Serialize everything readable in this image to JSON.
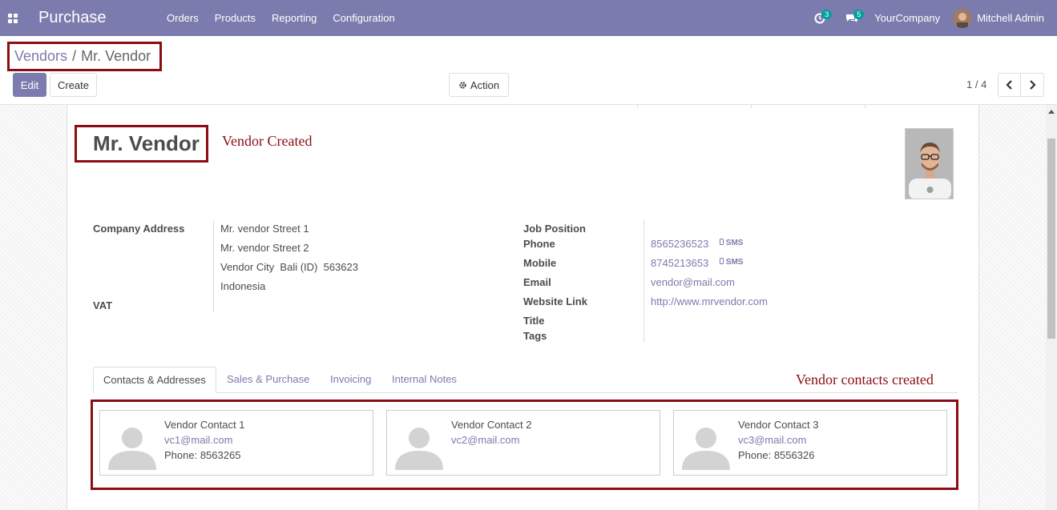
{
  "navbar": {
    "app_title": "Purchase",
    "menu": [
      "Orders",
      "Products",
      "Reporting",
      "Configuration"
    ],
    "activity_count": "3",
    "messages_count": "5",
    "company": "YourCompany",
    "user": "Mitchell Admin"
  },
  "breadcrumb": {
    "parent": "Vendors",
    "separator": "/",
    "current": "Mr. Vendor"
  },
  "buttons": {
    "edit": "Edit",
    "create": "Create",
    "action": "Action"
  },
  "pager": {
    "value": "1 / 4"
  },
  "partner": {
    "name": "Mr. Vendor",
    "left_fields": {
      "company_address_label": "Company Address",
      "street1": "Mr. vendor Street 1",
      "street2": "Mr. vendor Street 2",
      "city_line": "Vendor City  Bali (ID)  563623",
      "country": "Indonesia",
      "vat_label": "VAT"
    },
    "right_fields": {
      "job_position_label": "Job Position",
      "phone_label": "Phone",
      "phone": "8565236523",
      "mobile_label": "Mobile",
      "mobile": "8745213653",
      "sms_label": "SMS",
      "email_label": "Email",
      "email": "vendor@mail.com",
      "website_label": "Website Link",
      "website": "http://www.mrvendor.com",
      "title_label": "Title",
      "tags_label": "Tags"
    }
  },
  "annotations": {
    "vendor_created": "Vendor Created",
    "contacts_created": "Vendor contacts created"
  },
  "tabs": [
    "Contacts & Addresses",
    "Sales & Purchase",
    "Invoicing",
    "Internal Notes"
  ],
  "contacts": [
    {
      "name": "Vendor Contact 1",
      "email": "vc1@mail.com",
      "phone": "Phone: 8563265"
    },
    {
      "name": "Vendor Contact 2",
      "email": "vc2@mail.com",
      "phone": ""
    },
    {
      "name": "Vendor Contact 3",
      "email": "vc3@mail.com",
      "phone": "Phone: 8556326"
    }
  ],
  "colors": {
    "brand": "#7c7bad",
    "annotation": "#8b0d14"
  }
}
